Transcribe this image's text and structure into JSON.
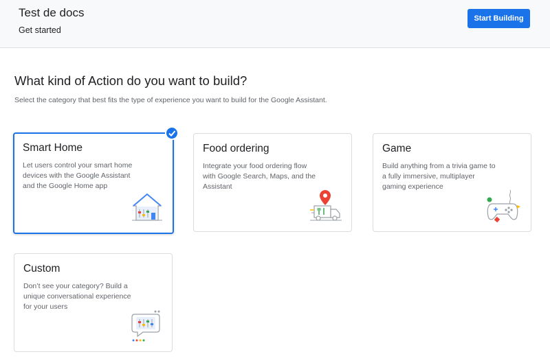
{
  "header": {
    "project_title": "Test de docs",
    "subtitle": "Get started",
    "start_button_label": "Start Building"
  },
  "main": {
    "heading": "What kind of Action do you want to build?",
    "subheading": "Select the category that best fits the type of experience you want to build for the Google Assistant."
  },
  "cards": [
    {
      "title": "Smart Home",
      "description": "Let users control your smart home devices with the Google Assistant and the Google Home app",
      "selected": true,
      "icon": "smart-home-icon"
    },
    {
      "title": "Food ordering",
      "description": "Integrate your food ordering flow with Google Search, Maps, and the Assistant",
      "selected": false,
      "icon": "food-truck-icon"
    },
    {
      "title": "Game",
      "description": "Build anything from a trivia game to a fully immersive, multiplayer gaming experience",
      "selected": false,
      "icon": "game-controller-icon"
    },
    {
      "title": "Custom",
      "description": "Don’t see your category? Build a unique conversational experience for your users",
      "selected": false,
      "icon": "custom-chat-icon"
    }
  ],
  "colors": {
    "accent": "#1a73e8",
    "google_red": "#ea4335",
    "google_yellow": "#fbbc04",
    "google_green": "#34a853"
  }
}
